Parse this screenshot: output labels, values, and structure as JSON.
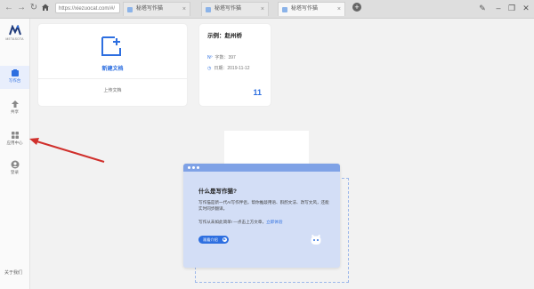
{
  "browser": {
    "address": "https://xiezuocat.com/#/",
    "tabs": [
      {
        "label": "秘塔写作猫",
        "active": false
      },
      {
        "label": "秘塔写作猫",
        "active": false
      },
      {
        "label": "秘塔写作猫",
        "active": true
      }
    ],
    "icons": [
      "back-icon",
      "forward-icon",
      "reload-icon",
      "home-icon",
      "new-tab-icon",
      "pin-icon",
      "minimize-icon",
      "restore-icon",
      "close-icon"
    ]
  },
  "sidebar": {
    "logo_text": "METASOTA",
    "items": [
      {
        "label": "写作台",
        "icon": "writing-icon",
        "active": true
      },
      {
        "label": "共享",
        "icon": "share-icon",
        "active": false
      },
      {
        "label": "应用中心",
        "icon": "apps-icon",
        "active": false
      },
      {
        "label": "登录",
        "icon": "user-icon",
        "active": false
      }
    ],
    "about": "关于我们"
  },
  "new_doc": {
    "title": "新建文档",
    "upload": "上传文档"
  },
  "sample_doc": {
    "title": "示例：赵州桥",
    "word_count": "字数：397",
    "date": "日期：2019-11-12",
    "count": "11"
  },
  "intro": {
    "title": "什么是写作猫?",
    "text": "写作猫是新一代AI写作伴侣，帮你推敲用语、斟酌文法、改写文风，还能实时同步翻译。",
    "question": "写作从未如此简单! —",
    "question_more": "点击上方文章，",
    "question_link": "立即体验",
    "button": "观看介绍"
  },
  "colors": {
    "accent": "#2e6fe0",
    "annotation_arrow": "#d0302c",
    "intro_bg": "#d3def6"
  }
}
